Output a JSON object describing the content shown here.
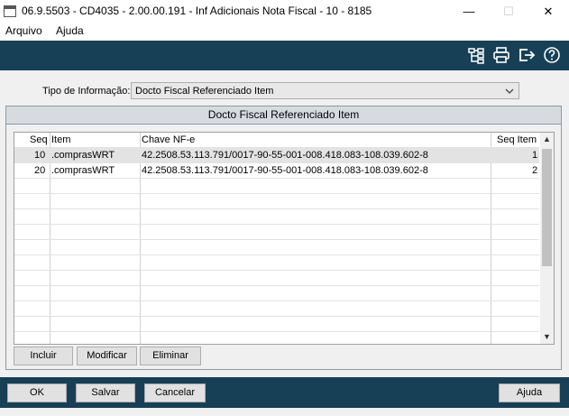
{
  "window": {
    "title": "06.9.5503 - CD4035 - 2.00.00.191 - Inf Adicionais Nota Fiscal - 10 - 8185",
    "minimize_glyph": "—",
    "maximize_glyph": "☐",
    "close_glyph": "✕"
  },
  "menu": {
    "items": [
      {
        "label": "Arquivo"
      },
      {
        "label": "Ajuda"
      }
    ]
  },
  "toolbar": {
    "icons": [
      "tree-structure-icon",
      "printer-icon",
      "exit-icon",
      "help-icon"
    ],
    "color": "#174057"
  },
  "form": {
    "tipo_label": "Tipo de Informação:",
    "tipo_value": "Docto Fiscal Referenciado Item"
  },
  "group": {
    "title": "Docto Fiscal Referenciado Item"
  },
  "grid": {
    "headers": [
      "Seq",
      "Item",
      "Chave NF-e",
      "Seq Item"
    ],
    "rows": [
      {
        "seq": "10",
        "item": ".comprasWRT",
        "chave": "42.2508.53.113.791/0017-90-55-001-008.418.083-108.039.602-8",
        "seq_item": "1"
      },
      {
        "seq": "20",
        "item": ".comprasWRT",
        "chave": "42.2508.53.113.791/0017-90-55-001-008.418.083-108.039.602-8",
        "seq_item": "2"
      }
    ]
  },
  "actions": {
    "incluir": "Incluir",
    "modificar": "Modificar",
    "eliminar": "Eliminar"
  },
  "footer": {
    "ok": "OK",
    "salvar": "Salvar",
    "cancelar": "Cancelar",
    "ajuda": "Ajuda"
  }
}
